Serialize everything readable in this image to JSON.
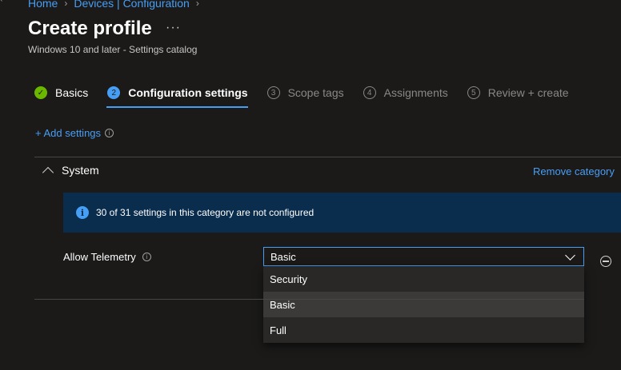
{
  "breadcrumb": {
    "home": "Home",
    "devices": "Devices | Configuration"
  },
  "header": {
    "title": "Create profile",
    "more": "···",
    "subtitle": "Windows 10 and later - Settings catalog"
  },
  "steps": [
    {
      "num": "✓",
      "label": "Basics",
      "state": "done"
    },
    {
      "num": "2",
      "label": "Configuration settings",
      "state": "active"
    },
    {
      "num": "3",
      "label": "Scope tags",
      "state": "todo"
    },
    {
      "num": "4",
      "label": "Assignments",
      "state": "todo"
    },
    {
      "num": "5",
      "label": "Review + create",
      "state": "todo"
    }
  ],
  "add_settings": "+ Add settings",
  "category": {
    "name": "System",
    "remove": "Remove category"
  },
  "info_banner": "30 of 31 settings in this category are not configured",
  "setting": {
    "label": "Allow Telemetry",
    "value": "Basic",
    "options": [
      "Security",
      "Basic",
      "Full"
    ],
    "selected_index": 1
  },
  "colors": {
    "accent": "#479ef5",
    "success": "#6bb700",
    "background": "#1b1a19",
    "banner": "#0a2d4e"
  }
}
